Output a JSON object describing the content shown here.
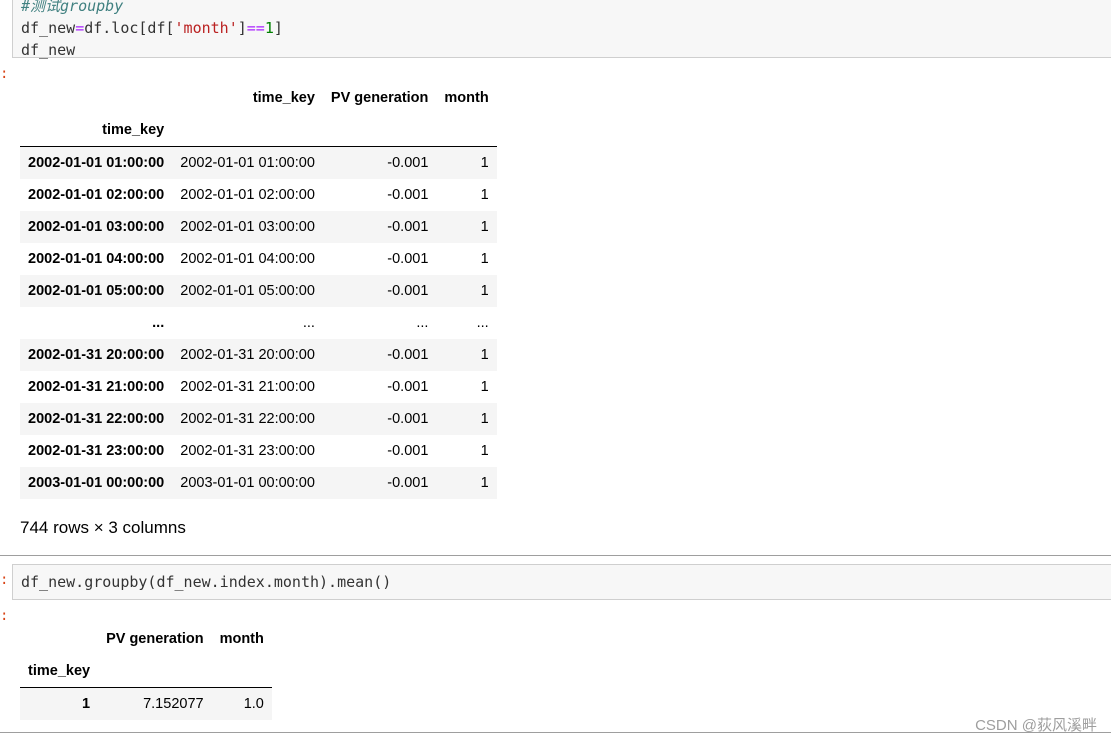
{
  "cell1": {
    "comment": "#测试groupby",
    "line1_prefix": "df_new",
    "line1_eq": "=",
    "line1_mid": "df.loc[df[",
    "line1_str": "'month'",
    "line1_close": "]",
    "line1_op": "==",
    "line1_num": "1",
    "line1_end": "]",
    "line2": "df_new",
    "output_prompt": ":"
  },
  "table1": {
    "columns": [
      "time_key",
      "PV generation",
      "month"
    ],
    "index_name": "time_key",
    "rows": [
      {
        "idx": "2002-01-01 01:00:00",
        "time_key": "2002-01-01 01:00:00",
        "pv": "-0.001",
        "month": "1"
      },
      {
        "idx": "2002-01-01 02:00:00",
        "time_key": "2002-01-01 02:00:00",
        "pv": "-0.001",
        "month": "1"
      },
      {
        "idx": "2002-01-01 03:00:00",
        "time_key": "2002-01-01 03:00:00",
        "pv": "-0.001",
        "month": "1"
      },
      {
        "idx": "2002-01-01 04:00:00",
        "time_key": "2002-01-01 04:00:00",
        "pv": "-0.001",
        "month": "1"
      },
      {
        "idx": "2002-01-01 05:00:00",
        "time_key": "2002-01-01 05:00:00",
        "pv": "-0.001",
        "month": "1"
      },
      {
        "idx": "...",
        "time_key": "...",
        "pv": "...",
        "month": "..."
      },
      {
        "idx": "2002-01-31 20:00:00",
        "time_key": "2002-01-31 20:00:00",
        "pv": "-0.001",
        "month": "1"
      },
      {
        "idx": "2002-01-31 21:00:00",
        "time_key": "2002-01-31 21:00:00",
        "pv": "-0.001",
        "month": "1"
      },
      {
        "idx": "2002-01-31 22:00:00",
        "time_key": "2002-01-31 22:00:00",
        "pv": "-0.001",
        "month": "1"
      },
      {
        "idx": "2002-01-31 23:00:00",
        "time_key": "2002-01-31 23:00:00",
        "pv": "-0.001",
        "month": "1"
      },
      {
        "idx": "2003-01-01 00:00:00",
        "time_key": "2003-01-01 00:00:00",
        "pv": "-0.001",
        "month": "1"
      }
    ],
    "shape": "744 rows × 3 columns"
  },
  "cell2": {
    "input_prompt": ":",
    "code": "df_new.groupby(df_new.index.month).mean()",
    "output_prompt": ":"
  },
  "table2": {
    "columns": [
      "PV generation",
      "month"
    ],
    "index_name": "time_key",
    "rows": [
      {
        "idx": "1",
        "pv": "7.152077",
        "month": "1.0"
      }
    ]
  },
  "watermark": "CSDN @荻风溪畔"
}
